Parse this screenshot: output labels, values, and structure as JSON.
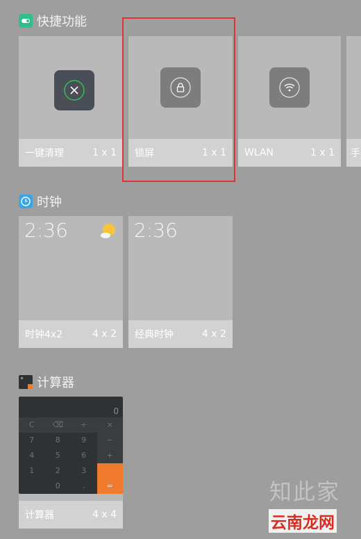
{
  "sections": {
    "quick": {
      "title": "快捷功能"
    },
    "clock": {
      "title": "时钟"
    },
    "calculator": {
      "title": "计算器"
    }
  },
  "quick_tiles": [
    {
      "label": "一键清理",
      "size": "1 x 1",
      "icon": "cleanup-x-icon"
    },
    {
      "label": "锁屏",
      "size": "1 x 1",
      "icon": "lock-icon"
    },
    {
      "label": "WLAN",
      "size": "1 x 1",
      "icon": "wifi-icon"
    },
    {
      "label": "手",
      "size": "",
      "icon": ""
    }
  ],
  "clock_tiles": [
    {
      "time": "2:36",
      "label": "时钟4x2",
      "size": "4 x 2",
      "weather_icon": "sun-cloud-icon"
    },
    {
      "time": "2:36",
      "label": "经典时钟",
      "size": "4 x 2"
    }
  ],
  "calculator_tile": {
    "display": "0",
    "keys": [
      [
        "C",
        "⌫",
        "÷",
        "×"
      ],
      [
        "7",
        "8",
        "9",
        "−"
      ],
      [
        "4",
        "5",
        "6",
        "+"
      ],
      [
        "1",
        "2",
        "3",
        ""
      ],
      [
        "",
        "0",
        ".",
        "="
      ]
    ],
    "label": "计算器",
    "size": "4 x 4"
  },
  "watermark": {
    "top": "知此家",
    "bottom": "云南龙网"
  },
  "colors": {
    "highlight": "#e0313a",
    "calc_accent": "#f07a2e",
    "clock_icon": "#3aa6e8",
    "quick_icon": "#2fbf8a"
  }
}
